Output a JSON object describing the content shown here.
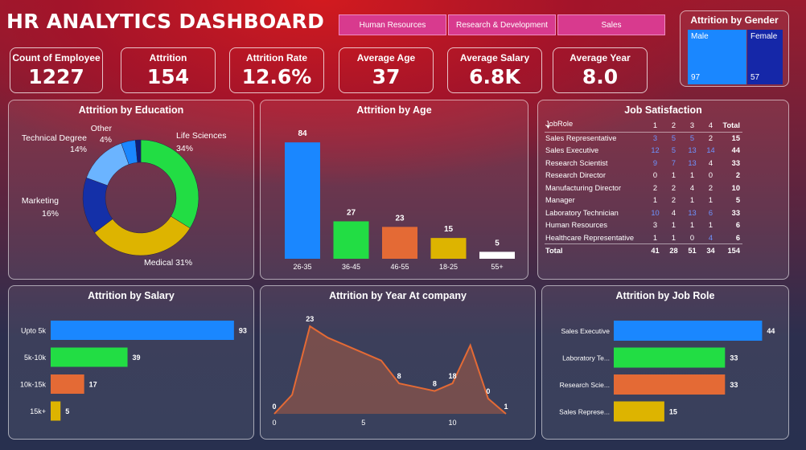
{
  "title": "HR ANALYTICS DASHBOARD",
  "slicers": [
    "Human Resources",
    "Research & Development",
    "Sales"
  ],
  "gender": {
    "title": "Attrition by Gender",
    "male_label": "Male",
    "male_value": "97",
    "female_label": "Female",
    "female_value": "57",
    "male_color": "#1a87ff",
    "female_color": "#1527a8"
  },
  "kpis": [
    {
      "label": "Count of Employee",
      "value": "1227"
    },
    {
      "label": "Attrition",
      "value": "154"
    },
    {
      "label": "Attrition Rate",
      "value": "12.6%"
    },
    {
      "label": "Average Age",
      "value": "37"
    },
    {
      "label": "Average Salary",
      "value": "6.8K"
    },
    {
      "label": "Average Year",
      "value": "8.0"
    }
  ],
  "panels": {
    "education": "Attrition by Education",
    "age": "Attrition by Age",
    "satisfaction": "Job Satisfaction",
    "salary": "Attrition by Salary",
    "year": "Attrition by Year At company",
    "jobrole": "Attrition by Job Role"
  },
  "satisfaction": {
    "headers": [
      "JobRole",
      "1",
      "2",
      "3",
      "4",
      "Total"
    ],
    "rows": [
      {
        "role": "Sales Representative",
        "v": [
          "3",
          "5",
          "5",
          "2"
        ],
        "total": "15",
        "blue": [
          1,
          1,
          1,
          0
        ]
      },
      {
        "role": "Sales Executive",
        "v": [
          "12",
          "5",
          "13",
          "14"
        ],
        "total": "44",
        "blue": [
          1,
          1,
          1,
          1
        ]
      },
      {
        "role": "Research Scientist",
        "v": [
          "9",
          "7",
          "13",
          "4"
        ],
        "total": "33",
        "blue": [
          1,
          1,
          1,
          0
        ]
      },
      {
        "role": "Research Director",
        "v": [
          "0",
          "1",
          "1",
          "0"
        ],
        "total": "2",
        "blue": [
          0,
          0,
          0,
          0
        ]
      },
      {
        "role": "Manufacturing Director",
        "v": [
          "2",
          "2",
          "4",
          "2"
        ],
        "total": "10",
        "blue": [
          0,
          0,
          0,
          0
        ]
      },
      {
        "role": "Manager",
        "v": [
          "1",
          "2",
          "1",
          "1"
        ],
        "total": "5",
        "blue": [
          0,
          0,
          0,
          0
        ]
      },
      {
        "role": "Laboratory Technician",
        "v": [
          "10",
          "4",
          "13",
          "6"
        ],
        "total": "33",
        "blue": [
          1,
          0,
          1,
          1
        ]
      },
      {
        "role": "Human Resources",
        "v": [
          "3",
          "1",
          "1",
          "1"
        ],
        "total": "6",
        "blue": [
          0,
          0,
          0,
          0
        ]
      },
      {
        "role": "Healthcare Representative",
        "v": [
          "1",
          "1",
          "0",
          "4"
        ],
        "total": "6",
        "blue": [
          0,
          0,
          0,
          1
        ]
      }
    ],
    "total_row": {
      "role": "Total",
      "v": [
        "41",
        "28",
        "51",
        "34"
      ],
      "total": "154"
    }
  },
  "chart_data": [
    {
      "type": "pie",
      "title": "Attrition by Education",
      "donut": true,
      "slices": [
        {
          "label": "Life Sciences",
          "pct_label": "34%",
          "value": 34,
          "color": "#22dd44"
        },
        {
          "label": "Medical",
          "pct_label": "31%",
          "value": 31,
          "color": "#ddb400"
        },
        {
          "label": "Marketing",
          "pct_label": "16%",
          "value": 16,
          "color": "#1430a8"
        },
        {
          "label": "Technical Degree",
          "pct_label": "14%",
          "value": 14,
          "color": "#6bb4ff"
        },
        {
          "label": "Other",
          "pct_label": "4%",
          "value": 4,
          "color": "#1a87ff"
        },
        {
          "label": "",
          "pct_label": "",
          "value": 1.5,
          "color": "#0e1f7a"
        }
      ]
    },
    {
      "type": "bar",
      "title": "Attrition by Age",
      "categories": [
        "26-35",
        "36-45",
        "46-55",
        "18-25",
        "55+"
      ],
      "values": [
        84,
        27,
        23,
        15,
        5
      ],
      "colors": [
        "#1a87ff",
        "#22dd44",
        "#e46a35",
        "#ddb400",
        "#ffffff"
      ],
      "ylim": [
        0,
        90
      ]
    },
    {
      "type": "bar",
      "orientation": "horizontal",
      "title": "Attrition by Salary",
      "categories": [
        "Upto 5k",
        "5k-10k",
        "10k-15k",
        "15k+"
      ],
      "values": [
        93,
        39,
        17,
        5
      ],
      "colors": [
        "#1a87ff",
        "#22dd44",
        "#e46a35",
        "#ddb400"
      ],
      "xlim": [
        0,
        100
      ]
    },
    {
      "type": "area",
      "title": "Attrition by Year At company",
      "x": [
        0,
        1,
        2,
        3,
        4,
        5,
        6,
        7,
        8,
        9,
        10,
        11,
        12,
        13
      ],
      "y": [
        0,
        5,
        23,
        20,
        18,
        16,
        14,
        8,
        7,
        6,
        8,
        18,
        4,
        0
      ],
      "point_labels": [
        {
          "x": 0,
          "label": "0"
        },
        {
          "x": 2,
          "label": "23"
        },
        {
          "x": 7,
          "label": "8"
        },
        {
          "x": 9,
          "label": "8"
        },
        {
          "x": 10,
          "label": "18"
        },
        {
          "x": 12,
          "label": "0"
        },
        {
          "x": 13,
          "label": "1"
        }
      ],
      "x_ticks": [
        "0",
        "5",
        "10"
      ],
      "color": "#e46a35"
    },
    {
      "type": "bar",
      "orientation": "horizontal",
      "title": "Attrition by Job Role",
      "categories": [
        "Sales Executive",
        "Laboratory Te...",
        "Research Scie...",
        "Sales Represe..."
      ],
      "values": [
        44,
        33,
        33,
        15
      ],
      "colors": [
        "#1a87ff",
        "#22dd44",
        "#e46a35",
        "#ddb400"
      ],
      "xlim": [
        0,
        47
      ]
    }
  ]
}
